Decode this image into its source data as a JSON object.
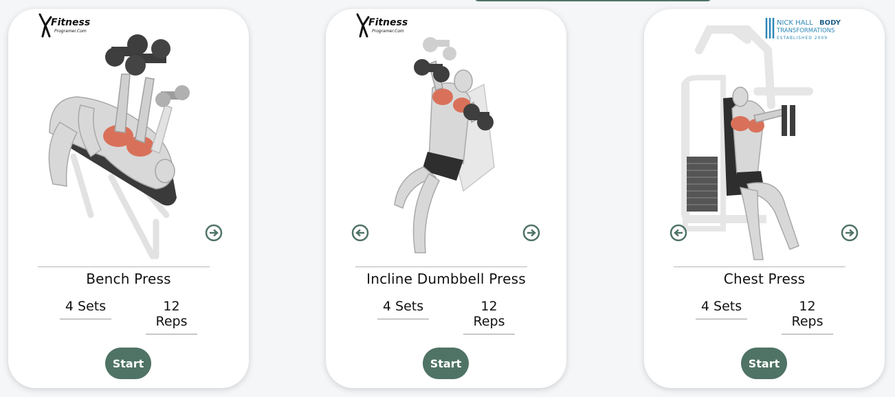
{
  "cards": [
    {
      "name": "Bench Press",
      "sets": "4 Sets",
      "reps": "12 Reps",
      "start_label": "Start",
      "logo": {
        "line1": "Fitness",
        "line2": "Programer.Com"
      },
      "arrows": [
        "arrow-right-icon"
      ]
    },
    {
      "name": "Incline Dumbbell Press",
      "sets": "4 Sets",
      "reps": "12 Reps",
      "start_label": "Start",
      "logo": {
        "line1": "Fitness",
        "line2": "Programer.Com"
      },
      "arrows": [
        "arrow-left-icon",
        "arrow-right-icon"
      ]
    },
    {
      "name": "Chest Press",
      "sets": "4 Sets",
      "reps": "12 Reps",
      "start_label": "Start",
      "logo": {
        "line1": "NICK HALL",
        "line1b": "BODY",
        "line2": "TRANSFORMATIONS",
        "line3": "ESTABLISHED 2009"
      },
      "arrows": [
        "arrow-left-icon",
        "arrow-right-icon"
      ]
    }
  ],
  "colors": {
    "accent": "#4f7365",
    "muscle": "#d9715a",
    "background": "#f4f6f8"
  }
}
